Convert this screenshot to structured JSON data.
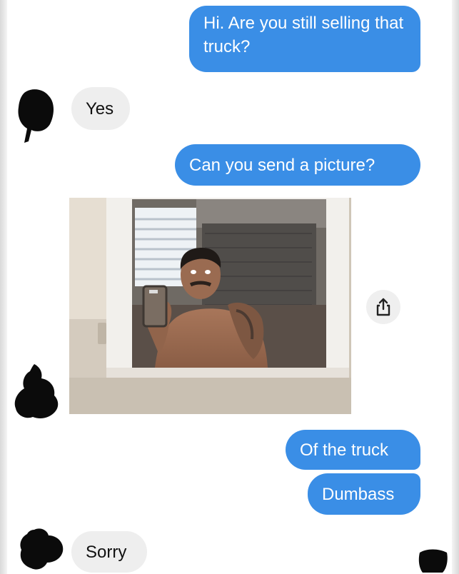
{
  "conversation": {
    "messages": [
      {
        "sender": "me",
        "text": "Hi. Are you still selling that truck?"
      },
      {
        "sender": "them",
        "text": "Yes"
      },
      {
        "sender": "me",
        "text": "Can you send a picture?"
      },
      {
        "sender": "them",
        "type": "photo"
      },
      {
        "sender": "me",
        "text": "Of the truck"
      },
      {
        "sender": "me",
        "text": "Dumbass"
      },
      {
        "sender": "them",
        "text": "Sorry"
      }
    ]
  },
  "colors": {
    "outgoing_bubble": "#3a8ee6",
    "incoming_bubble": "#eeeeee",
    "background": "#ffffff"
  },
  "icons": {
    "share": "share-icon"
  }
}
